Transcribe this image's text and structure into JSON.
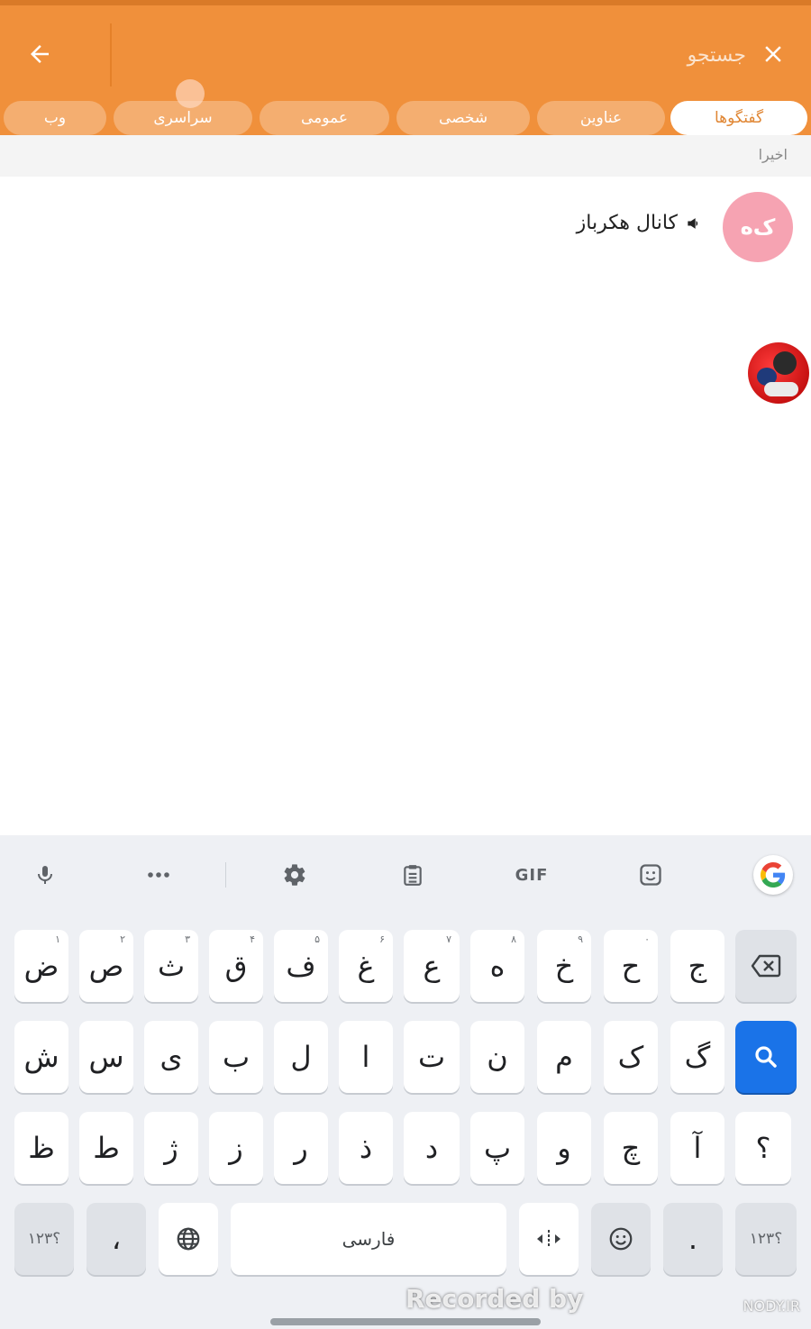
{
  "colors": {
    "accent": "#F0903B",
    "tab_inactive": "#F4AE70",
    "avatar_pink": "#F6A3B2",
    "enter_blue": "#1a73e8"
  },
  "header": {
    "back_icon": "arrow-left-icon",
    "close_icon": "close-icon",
    "search_placeholder": "جستجو",
    "tabs": [
      {
        "label": "گفتگوها",
        "active": true
      },
      {
        "label": "عناوین",
        "active": false
      },
      {
        "label": "شخصی",
        "active": false
      },
      {
        "label": "عمومی",
        "active": false
      },
      {
        "label": "سراسری",
        "active": false
      },
      {
        "label": "وب",
        "active": false
      }
    ]
  },
  "recent": {
    "label": "اخیرا",
    "items": [
      {
        "avatar_text": "ک‌ه",
        "title": "کانال هکرباز",
        "icon": "megaphone-icon"
      }
    ]
  },
  "keyboard": {
    "toolbar": {
      "google": "google-icon",
      "sticker": "sticker-icon",
      "gif": "GIF",
      "clipboard": "clipboard-icon",
      "settings": "gear-icon",
      "more": "more-icon",
      "mic": "mic-icon"
    },
    "row1": [
      {
        "char": "ض",
        "hint": "۱"
      },
      {
        "char": "ص",
        "hint": "۲"
      },
      {
        "char": "ث",
        "hint": "۳"
      },
      {
        "char": "ق",
        "hint": "۴"
      },
      {
        "char": "ف",
        "hint": "۵"
      },
      {
        "char": "غ",
        "hint": "۶"
      },
      {
        "char": "ع",
        "hint": "۷"
      },
      {
        "char": "ه",
        "hint": "۸"
      },
      {
        "char": "خ",
        "hint": "۹"
      },
      {
        "char": "ح",
        "hint": "۰"
      },
      {
        "char": "ج",
        "hint": ""
      }
    ],
    "row2": [
      "ش",
      "س",
      "ی",
      "ب",
      "ل",
      "ا",
      "ت",
      "ن",
      "م",
      "ک",
      "گ"
    ],
    "row3": [
      "ظ",
      "ط",
      "ژ",
      "ز",
      "ر",
      "ذ",
      "د",
      "پ",
      "و",
      "چ",
      "آ",
      "؟"
    ],
    "row4": {
      "symbols_left": "؟۱۲۳",
      "comma": "،",
      "space_label": "فارسی",
      "period": ".",
      "symbols_right": "؟۱۲۳"
    }
  },
  "overlay": {
    "recorded_by": "Recorded by",
    "site": "NODY.IR"
  }
}
